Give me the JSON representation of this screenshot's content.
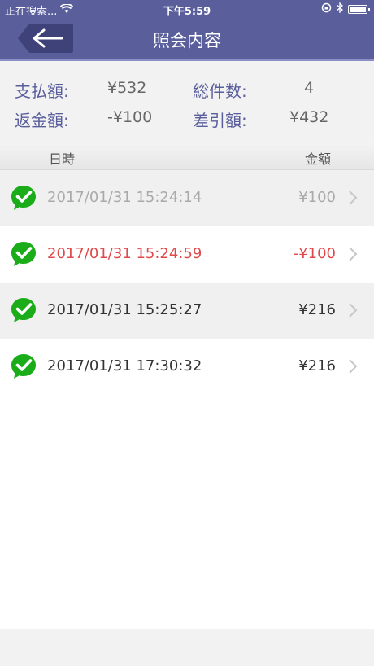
{
  "status_bar": {
    "carrier": "正在搜索...",
    "time": "下午5:59",
    "icons": [
      "wifi-icon",
      "orientation-lock-icon",
      "bluetooth-icon",
      "battery-icon"
    ]
  },
  "nav": {
    "title": "照会内容",
    "back_icon": "back-arrow-icon"
  },
  "summary": {
    "paid_label": "支払額:",
    "paid_value": "¥532",
    "count_label": "総件数:",
    "count_value": "4",
    "refund_label": "返金額:",
    "refund_value": "-¥100",
    "net_label": "差引額:",
    "net_value": "¥432"
  },
  "table": {
    "col_datetime": "日時",
    "col_amount": "金額",
    "rows": [
      {
        "time": "2017/01/31 15:24:14",
        "amount": "¥100",
        "status": "dimmed",
        "icon": "wechat-pay-check-icon"
      },
      {
        "time": "2017/01/31 15:24:59",
        "amount": "-¥100",
        "status": "refund",
        "icon": "wechat-pay-check-icon"
      },
      {
        "time": "2017/01/31 15:25:27",
        "amount": "¥216",
        "status": "normal",
        "icon": "wechat-pay-check-icon"
      },
      {
        "time": "2017/01/31 17:30:32",
        "amount": "¥216",
        "status": "normal",
        "icon": "wechat-pay-check-icon"
      }
    ]
  },
  "colors": {
    "nav_background": "#5a5f9c",
    "label_color": "#5a5f9c",
    "refund_red": "#e0494b",
    "dimmed_text": "#aaaaaa",
    "icon_green": "#1aad19"
  }
}
